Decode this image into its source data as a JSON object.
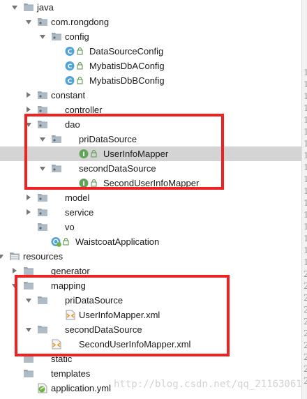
{
  "colors": {
    "selection": "#d4d4d4",
    "highlight_box": "#ee2222",
    "folder": "#9aa7b1",
    "class_icon": "#4fa3d9",
    "interface_icon": "#63a35c"
  },
  "tree": [
    {
      "label": "java",
      "icon": "folder",
      "arrow": "down",
      "name": "folder-java"
    },
    {
      "label": "com.rongdong",
      "icon": "package",
      "arrow": "down",
      "name": "package-com-rongdong"
    },
    {
      "label": "config",
      "icon": "package",
      "arrow": "down",
      "name": "package-config"
    },
    {
      "label": "DataSourceConfig",
      "icon": "class",
      "arrow": "none",
      "name": "file-datasourceconfig"
    },
    {
      "label": "MybatisDbAConfig",
      "icon": "class",
      "arrow": "none",
      "name": "file-mybatisdbaconfig"
    },
    {
      "label": "MybatisDbBConfig",
      "icon": "class",
      "arrow": "none",
      "name": "file-mybatisdbbconfig"
    },
    {
      "label": "constant",
      "icon": "package",
      "arrow": "right",
      "name": "package-constant"
    },
    {
      "label": "controller",
      "icon": "package",
      "arrow": "right",
      "name": "package-controller"
    },
    {
      "label": "dao",
      "icon": "package",
      "arrow": "down",
      "name": "package-dao"
    },
    {
      "label": "priDataSource",
      "icon": "package",
      "arrow": "down",
      "name": "package-pridatasource"
    },
    {
      "label": "UserInfoMapper",
      "icon": "interface",
      "arrow": "none",
      "name": "file-userinfomapper",
      "selected": true
    },
    {
      "label": "secondDataSource",
      "icon": "package",
      "arrow": "down",
      "name": "package-seconddatasource"
    },
    {
      "label": "SecondUserInfoMapper",
      "icon": "interface",
      "arrow": "none",
      "name": "file-seconduserinfomapper"
    },
    {
      "label": "model",
      "icon": "package",
      "arrow": "right",
      "name": "package-model"
    },
    {
      "label": "service",
      "icon": "package",
      "arrow": "right",
      "name": "package-service"
    },
    {
      "label": "vo",
      "icon": "package",
      "arrow": "none",
      "name": "package-vo"
    },
    {
      "label": "WaistcoatApplication",
      "icon": "spring-app",
      "arrow": "none",
      "name": "file-waistcoatapplication"
    },
    {
      "label": "resources",
      "icon": "resources-folder",
      "arrow": "down",
      "name": "folder-resources"
    },
    {
      "label": "generator",
      "icon": "folder",
      "arrow": "right",
      "name": "folder-generator"
    },
    {
      "label": "mapping",
      "icon": "folder",
      "arrow": "down",
      "name": "folder-mapping"
    },
    {
      "label": "priDataSource",
      "icon": "folder",
      "arrow": "down",
      "name": "folder-pridatasource"
    },
    {
      "label": "UserInfoMapper.xml",
      "icon": "xml",
      "arrow": "none",
      "name": "file-userinfomapper-xml"
    },
    {
      "label": "secondDataSource",
      "icon": "folder",
      "arrow": "down",
      "name": "folder-seconddatasource"
    },
    {
      "label": "SecondUserInfoMapper.xml",
      "icon": "xml",
      "arrow": "none",
      "name": "file-seconduserinfomapper-xml"
    },
    {
      "label": "static",
      "icon": "folder",
      "arrow": "none",
      "name": "folder-static"
    },
    {
      "label": "templates",
      "icon": "folder",
      "arrow": "none",
      "name": "folder-templates"
    },
    {
      "label": "application.yml",
      "icon": "yml",
      "arrow": "none",
      "name": "file-application-yml"
    }
  ],
  "gutter_digits": [
    "1",
    "1",
    "1",
    "1",
    "1",
    "1",
    "1",
    "1",
    "1",
    "1",
    "1",
    "1",
    "1",
    "1",
    "1",
    "1",
    "1",
    "2",
    "2",
    "2",
    "2",
    "2",
    "2",
    "2",
    "2",
    "2",
    "2"
  ],
  "watermark": "http://blog.csdn.net/qq_21163061"
}
